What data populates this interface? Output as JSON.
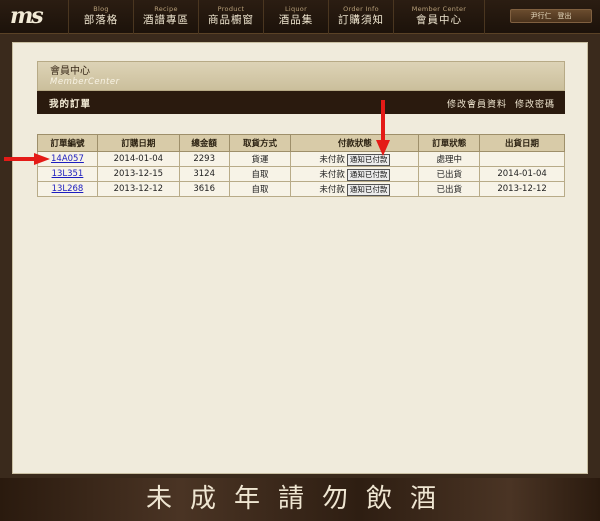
{
  "logo": "ms",
  "nav": [
    {
      "en": "Blog",
      "zh": "部落格"
    },
    {
      "en": "Recipe",
      "zh": "酒譜專區"
    },
    {
      "en": "Product",
      "zh": "商品櫥窗"
    },
    {
      "en": "Liquor",
      "zh": "酒品集"
    },
    {
      "en": "Order Info",
      "zh": "訂購須知"
    },
    {
      "en": "Member Center",
      "zh": "會員中心"
    }
  ],
  "user": {
    "name": "尹行仁",
    "logout": "登出"
  },
  "member": {
    "title": "會員中心",
    "subtitle": "MemberCenter",
    "section": "我的訂單",
    "links": [
      "修改會員資料",
      "修改密碼"
    ]
  },
  "table": {
    "headers": [
      "訂單編號",
      "訂購日期",
      "總金額",
      "取貨方式",
      "付款狀態",
      "訂單狀態",
      "出貨日期"
    ],
    "notify_label": "通知已付款",
    "rows": [
      {
        "id": "14A057",
        "date": "2014-01-04",
        "total": "2293",
        "method": "貨運",
        "pay": "未付款",
        "status": "處理中",
        "ship": ""
      },
      {
        "id": "13L351",
        "date": "2013-12-15",
        "total": "3124",
        "method": "自取",
        "pay": "未付款",
        "status": "已出貨",
        "ship": "2014-01-04"
      },
      {
        "id": "13L268",
        "date": "2013-12-12",
        "total": "3616",
        "method": "自取",
        "pay": "未付款",
        "status": "已出貨",
        "ship": "2013-12-12"
      }
    ]
  },
  "footer": "未成年請勿飲酒",
  "colors": {
    "arrow": "#e41b17",
    "link": "#1d1dbf",
    "bar": "#2a1a0e"
  }
}
